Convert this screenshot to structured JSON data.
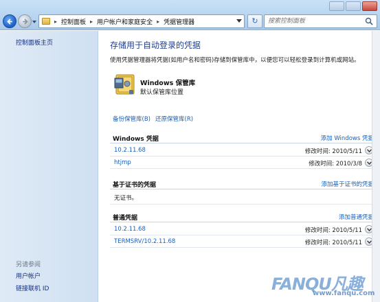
{
  "addressbar": {
    "crumbs": [
      "控制面板",
      "用户帐户和家庭安全",
      "凭据管理器"
    ],
    "search_placeholder": "搜索控制面板"
  },
  "leftpane": {
    "home_link": "控制面板主页",
    "see_also": "另请参阅",
    "links": [
      "用户帐户",
      "链接联机 ID"
    ]
  },
  "main": {
    "title": "存储用于自动登录的凭据",
    "description": "使用凭据管理器将凭据(如用户名和密码)存储到保管库中，以便您可以轻松登录到计算机或网站。",
    "vault": {
      "name": "Windows 保管库",
      "subtitle": "默认保管库位置"
    },
    "backup_link": "备份保管库(B)",
    "restore_link": "还原保管库(R)",
    "sections": [
      {
        "title": "Windows 凭据",
        "add": "添加 Windows 凭据",
        "items": [
          {
            "name": "10.2.11.68",
            "modified": "修改时间: 2010/5/11"
          },
          {
            "name": "htjmp",
            "modified": "修改时间: 2010/3/8"
          }
        ]
      },
      {
        "title": "基于证书的凭据",
        "add": "添加基于证书的凭据",
        "empty": "无证书。"
      },
      {
        "title": "普通凭据",
        "add": "添加普通凭据",
        "items": [
          {
            "name": "10.2.11.68",
            "modified": "修改时间: 2010/5/11"
          },
          {
            "name": "TERMSRV/10.2.11.68",
            "modified": "修改时间: 2010/5/11"
          }
        ]
      }
    ]
  },
  "icons": {
    "back": "back-arrow-icon",
    "forward": "forward-arrow-icon",
    "refresh": "refresh-icon",
    "search": "search-icon",
    "vault": "vault-safe-icon",
    "expand": "chevron-down-icon"
  },
  "watermark": {
    "text": "FANQU凡趣",
    "url": "www.fanqu.com"
  },
  "colors": {
    "link": "#1560c0",
    "title": "#1f3f8e",
    "leftpane": "#d8e6f4"
  }
}
